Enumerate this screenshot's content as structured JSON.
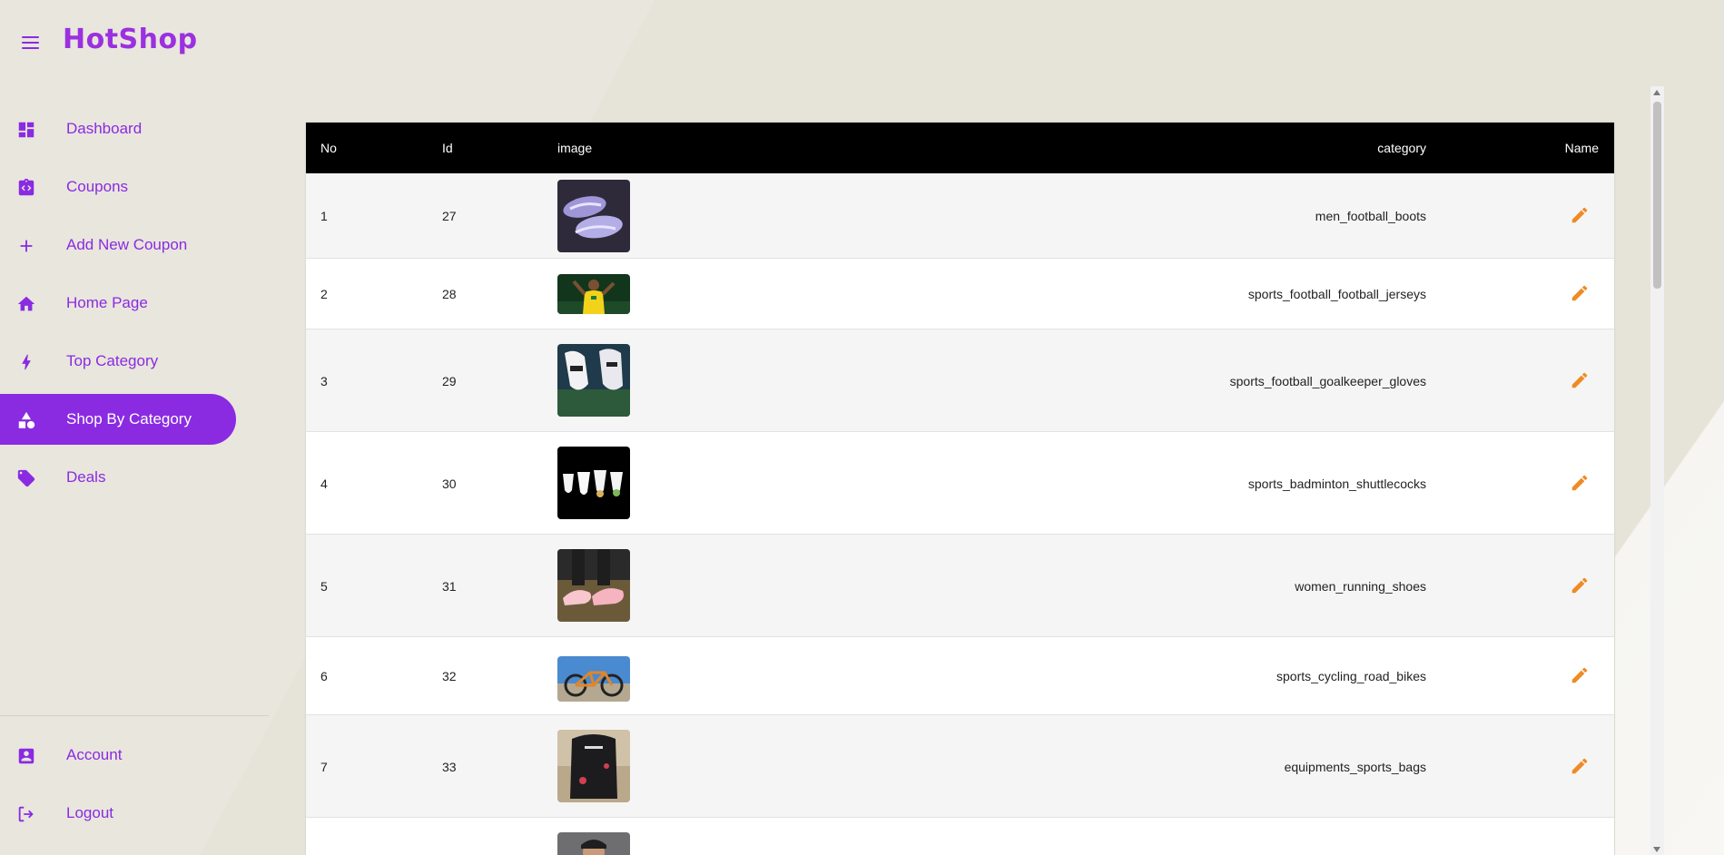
{
  "app": {
    "brand": "HotShop"
  },
  "sidebar": {
    "items": [
      {
        "label": "Dashboard",
        "icon": "dashboard-icon"
      },
      {
        "label": "Coupons",
        "icon": "coupon-icon"
      },
      {
        "label": "Add New Coupon",
        "icon": "plus-icon"
      },
      {
        "label": "Home Page",
        "icon": "home-icon"
      },
      {
        "label": "Top Category",
        "icon": "bolt-icon"
      },
      {
        "label": "Shop By Category",
        "icon": "category-icon",
        "active": true
      },
      {
        "label": "Deals",
        "icon": "tag-icon"
      }
    ],
    "bottom_items": [
      {
        "label": "Account",
        "icon": "account-icon"
      },
      {
        "label": "Logout",
        "icon": "logout-icon"
      }
    ]
  },
  "table": {
    "headers": {
      "no": "No",
      "id": "Id",
      "image": "image",
      "category": "category",
      "name": "Name"
    },
    "rows": [
      {
        "no": "1",
        "id": "27",
        "category": "men_football_boots"
      },
      {
        "no": "2",
        "id": "28",
        "category": "sports_football_football_jerseys"
      },
      {
        "no": "3",
        "id": "29",
        "category": "sports_football_goalkeeper_gloves"
      },
      {
        "no": "4",
        "id": "30",
        "category": "sports_badminton_shuttlecocks"
      },
      {
        "no": "5",
        "id": "31",
        "category": "women_running_shoes"
      },
      {
        "no": "6",
        "id": "32",
        "category": "sports_cycling_road_bikes"
      },
      {
        "no": "7",
        "id": "33",
        "category": "equipments_sports_bags"
      }
    ]
  },
  "colors": {
    "accent": "#8a2be2",
    "edit": "#f08a24",
    "header_bg": "#000000"
  }
}
